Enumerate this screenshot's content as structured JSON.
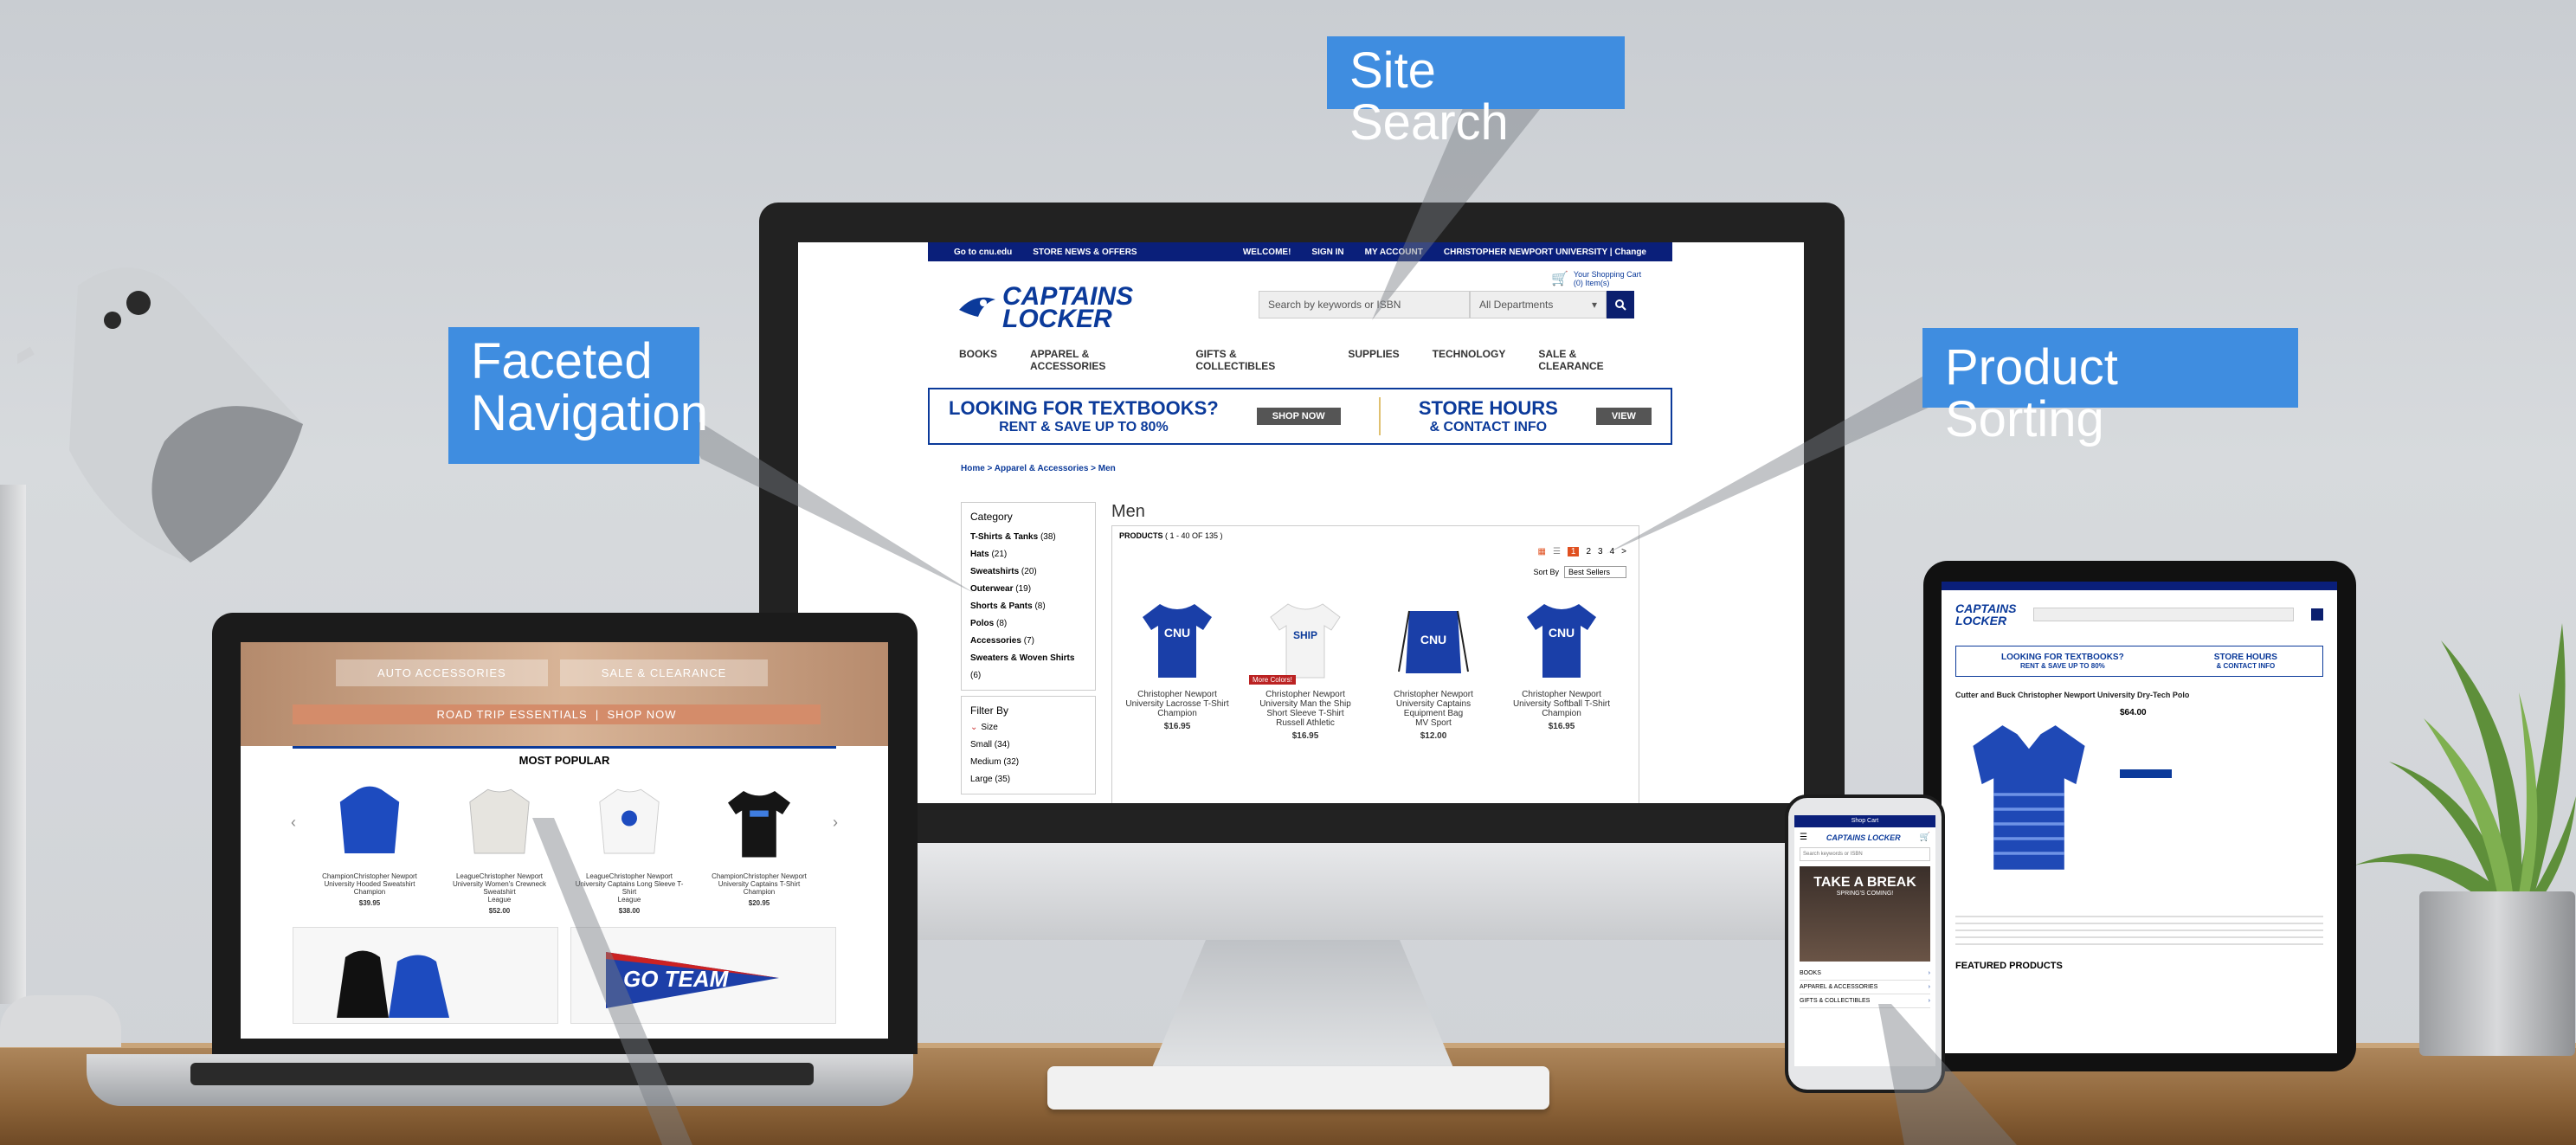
{
  "callouts": {
    "site_search": "Site Search",
    "faceted_navigation": "Faceted Navigation",
    "product_sorting": "Product Sorting"
  },
  "desktop_site": {
    "topbar": [
      "Go to cnu.edu",
      "STORE NEWS & OFFERS",
      "WELCOME!",
      "SIGN IN",
      "MY ACCOUNT",
      "CHRISTOPHER NEWPORT UNIVERSITY | Change"
    ],
    "logo": "CAPTAINS LOCKER",
    "search_placeholder": "Search by keywords or ISBN",
    "departments": "All Departments",
    "cart": "Your Shopping Cart",
    "cart_items": "(0) Item(s)",
    "nav": [
      "BOOKS",
      "APPAREL & ACCESSORIES",
      "GIFTS & COLLECTIBLES",
      "SUPPLIES",
      "TECHNOLOGY",
      "SALE & CLEARANCE"
    ],
    "banner_textbooks_title": "LOOKING FOR TEXTBOOKS?",
    "banner_textbooks_sub": "RENT & SAVE UP TO 80%",
    "banner_shop_now": "SHOP NOW",
    "banner_hours_title": "STORE HOURS",
    "banner_hours_sub": "& CONTACT INFO",
    "banner_view": "VIEW",
    "breadcrumb": "Home > Apparel & Accessories > Men",
    "page_heading": "Men",
    "products_label": "PRODUCTS",
    "products_count": "( 1 - 40 OF 135 )",
    "pages": [
      "1",
      "2",
      "3",
      "4",
      ">"
    ],
    "sort_by": "Sort By",
    "sort_value": "Best Sellers",
    "category_heading": "Category",
    "categories": [
      {
        "name": "T-Shirts & Tanks",
        "count": "(38)"
      },
      {
        "name": "Hats",
        "count": "(21)"
      },
      {
        "name": "Sweatshirts",
        "count": "(20)"
      },
      {
        "name": "Outerwear",
        "count": "(19)"
      },
      {
        "name": "Shorts & Pants",
        "count": "(8)"
      },
      {
        "name": "Polos",
        "count": "(8)"
      },
      {
        "name": "Accessories",
        "count": "(7)"
      },
      {
        "name": "Sweaters & Woven Shirts",
        "count": "(6)"
      }
    ],
    "filter_by": "Filter By",
    "size_heading": "Size",
    "sizes": [
      "Small (34)",
      "Medium (32)",
      "Large (35)"
    ],
    "products": [
      {
        "name": "Christopher Newport University Lacrosse T-Shirt",
        "brand": "Champion",
        "price": "$16.95",
        "color": "#1a3fa8"
      },
      {
        "name": "Christopher Newport University Man the Ship Short Sleeve T-Shirt",
        "brand": "Russell Athletic",
        "price": "$16.95",
        "color": "#f3f3f3",
        "tag": "More Colors!"
      },
      {
        "name": "Christopher Newport University Captains Equipment Bag",
        "brand": "MV Sport",
        "price": "$12.00",
        "color": "#1a3fa8"
      },
      {
        "name": "Christopher Newport University Softball T-Shirt",
        "brand": "Champion",
        "price": "$16.95",
        "color": "#1a3fa8"
      }
    ]
  },
  "laptop_site": {
    "pill_auto": "AUTO ACCESSORIES",
    "pill_sale": "SALE & CLEARANCE",
    "road_trip": "ROAD TRIP ESSENTIALS",
    "shop_now": "SHOP NOW",
    "most_popular": "MOST POPULAR",
    "products": [
      {
        "name": "ChampionChristopher Newport University Hooded Sweatshirt",
        "brand": "Champion",
        "price": "$39.95",
        "color": "#1d4bbf"
      },
      {
        "name": "LeagueChristopher Newport University Women's Crewneck Sweatshirt",
        "brand": "League",
        "price": "$52.00",
        "color": "#e6e4df"
      },
      {
        "name": "LeagueChristopher Newport University Captains Long Sleeve T-Shirt",
        "brand": "League",
        "price": "$38.00",
        "color": "#f6f6f6"
      },
      {
        "name": "ChampionChristopher Newport University Captains T-Shirt",
        "brand": "Champion",
        "price": "$20.95",
        "color": "#151515"
      }
    ],
    "go_team": "GO TEAM"
  },
  "tablet_site": {
    "logo": "CAPTAINS LOCKER",
    "banner_textbooks_title": "LOOKING FOR TEXTBOOKS?",
    "banner_textbooks_sub": "RENT & SAVE UP TO 80%",
    "banner_hours_title": "STORE HOURS",
    "banner_hours_sub": "& CONTACT INFO",
    "product_title": "Cutter and Buck Christopher Newport University Dry-Tech Polo",
    "price": "$64.00",
    "featured": "FEATURED PRODUCTS"
  },
  "phone_site": {
    "shop_cart": "Shop Cart",
    "logo": "CAPTAINS LOCKER",
    "search_placeholder": "Search keywords or ISBN",
    "hero": "TAKE A BREAK",
    "hero_sub": "SPRING'S COMING!",
    "menu": [
      "BOOKS",
      "APPAREL & ACCESSORIES",
      "GIFTS & COLLECTIBLES"
    ]
  }
}
